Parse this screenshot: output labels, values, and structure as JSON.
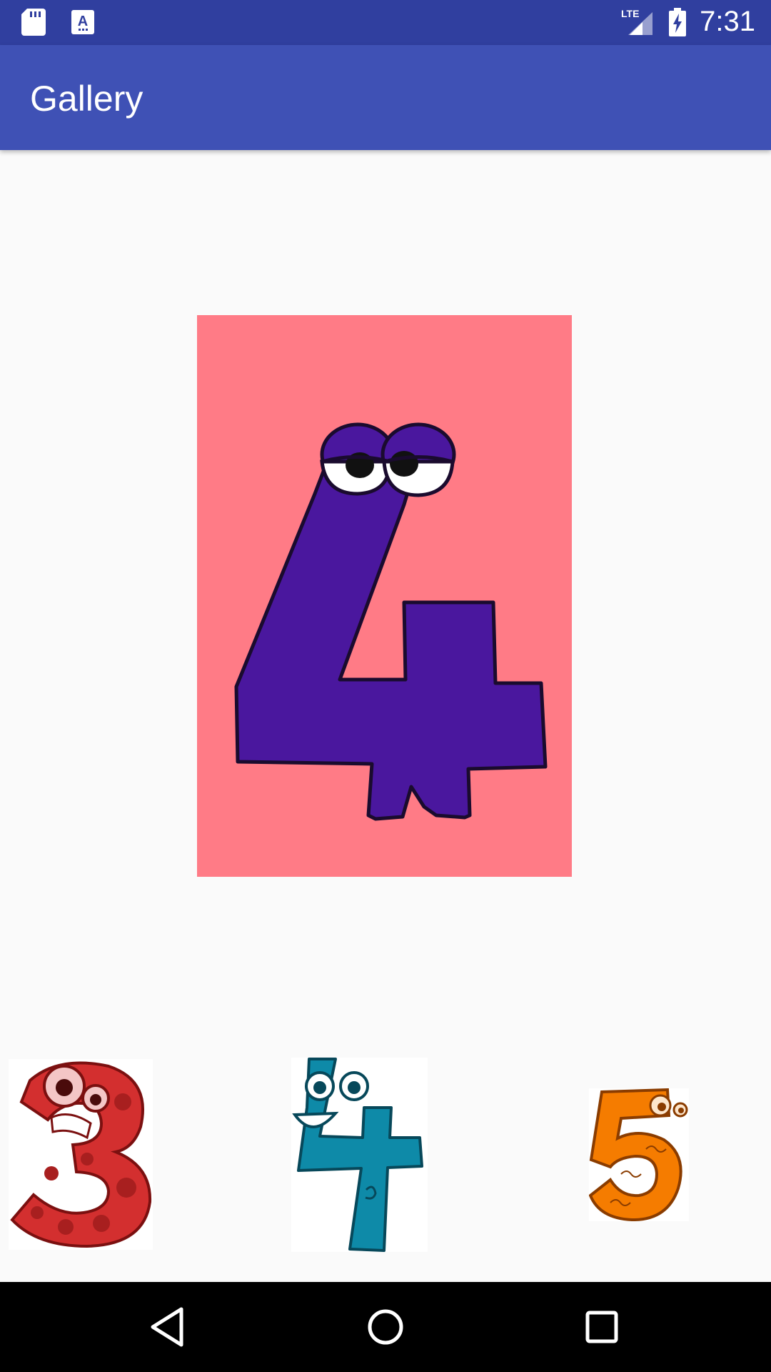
{
  "status_bar": {
    "time": "7:31",
    "network": "LTE",
    "left_icons": [
      "sd-card-icon",
      "text-a-icon"
    ],
    "right_icons": [
      "lte-signal-icon",
      "battery-charging-icon"
    ]
  },
  "app_bar": {
    "title": "Gallery"
  },
  "main_image": {
    "depicts": "purple cartoon number 4 with eyes on pink background",
    "background_color": "#ff7b86"
  },
  "thumbnails": [
    {
      "depicts": "red cartoon number 3",
      "color": "#d32f2f"
    },
    {
      "depicts": "teal cartoon number 4",
      "color": "#0e8aa8"
    },
    {
      "depicts": "orange cartoon number 5",
      "color": "#f57c00"
    }
  ],
  "nav_bar": {
    "buttons": [
      "back-icon",
      "home-icon",
      "recents-icon"
    ]
  },
  "colors": {
    "status_bar": "#303f9f",
    "app_bar": "#3f51b5",
    "background": "#fafafa"
  }
}
